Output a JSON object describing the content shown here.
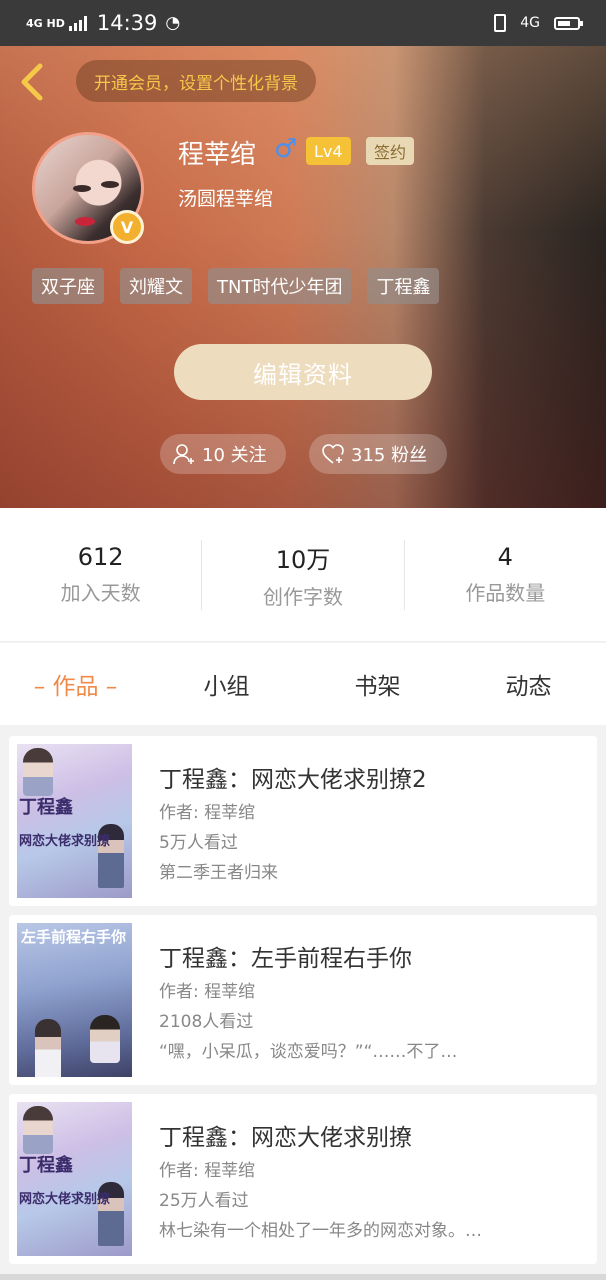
{
  "status_bar": {
    "network_label": "4G HD",
    "time": "14:39",
    "right_network": "4G"
  },
  "header": {
    "vip_prompt": "开通会员，设置个性化背景",
    "username": "程莘绾",
    "gender_symbol": "♂",
    "level": "Lv4",
    "signed_badge": "签约",
    "nickname": "汤圆程莘绾",
    "verified_badge": "V",
    "tags": [
      "双子座",
      "刘耀文",
      "TNT时代少年团",
      "丁程鑫"
    ],
    "edit_button": "编辑资料",
    "following_label": "10 关注",
    "followers_label": "315 粉丝"
  },
  "stats": [
    {
      "value": "612",
      "label": "加入天数"
    },
    {
      "value": "10万",
      "label": "创作字数"
    },
    {
      "value": "4",
      "label": "作品数量"
    }
  ],
  "tabs": [
    {
      "label": "– 作品 –",
      "active": true
    },
    {
      "label": "小组",
      "active": false
    },
    {
      "label": "书架",
      "active": false
    },
    {
      "label": "动态",
      "active": false
    }
  ],
  "books": [
    {
      "title": "丁程鑫：网恋大佬求别撩2",
      "author": "作者: 程莘绾",
      "views": "5万人看过",
      "desc": "第二季王者归来",
      "cover_text": "丁程鑫",
      "cover_sub": "网恋大佬求别撩"
    },
    {
      "title": "丁程鑫：左手前程右手你",
      "author": "作者: 程莘绾",
      "views": "2108人看过",
      "desc": "“嘿，小呆瓜，谈恋爱吗？”“……不了…",
      "cover_text": "左手前程右手你",
      "cover_sub": ""
    },
    {
      "title": "丁程鑫：网恋大佬求别撩",
      "author": "作者: 程莘绾",
      "views": "25万人看过",
      "desc": "林七染有一个相处了一年多的网恋对象。…",
      "cover_text": "丁程鑫",
      "cover_sub": "网恋大佬求别撩"
    }
  ],
  "colors": {
    "accent_orange": "#f08a4a",
    "vip_gold": "#f6c84a",
    "level_yellow": "#f5c237",
    "male_blue": "#4a90ee"
  },
  "icons": [
    "back-chevron-icon",
    "person-add-icon",
    "heart-add-icon",
    "male-icon",
    "verified-v-icon"
  ]
}
